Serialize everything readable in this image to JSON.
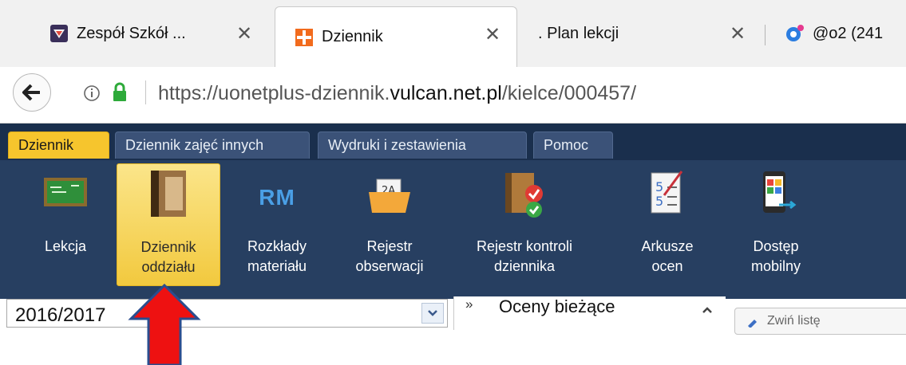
{
  "browser": {
    "tabs": [
      {
        "title": "Zespół Szkół ...",
        "icon": "school-shield-icon",
        "active": false
      },
      {
        "title": "Dziennik",
        "icon": "vulcan-plus-icon",
        "active": true
      },
      {
        "title": ". Plan lekcji",
        "icon": "",
        "active": false
      },
      {
        "title": "@o2 (241",
        "icon": "o2-mail-icon",
        "active": false
      }
    ],
    "url_path_prefix": "https://uonetplus-dziennik.",
    "url_host": "vulcan.net.pl",
    "url_suffix": "/kielce/000457/"
  },
  "app": {
    "menu_tabs": [
      {
        "label": "Dziennik",
        "active": true
      },
      {
        "label": "Dziennik zajęć innych",
        "active": false
      },
      {
        "label": "Wydruki i zestawienia",
        "active": false
      },
      {
        "label": "Pomoc",
        "active": false
      }
    ],
    "ribbon": [
      {
        "line1": "Lekcja",
        "line2": "",
        "icon": "chalkboard-icon",
        "selected": false
      },
      {
        "line1": "Dziennik",
        "line2": "oddziału",
        "icon": "class-register-book-icon",
        "selected": true
      },
      {
        "line1": "Rozkłady",
        "line2": "materiału",
        "icon": "rm-icon",
        "icon_text": "RM",
        "selected": false
      },
      {
        "line1": "Rejestr",
        "line2": "obserwacji",
        "icon": "folder-observation-icon",
        "selected": false
      },
      {
        "line1": "Rejestr kontroli",
        "line2": "dziennika",
        "icon": "register-check-icon",
        "selected": false
      },
      {
        "line1": "Arkusze",
        "line2": "ocen",
        "icon": "grade-sheet-icon",
        "selected": false
      },
      {
        "line1": "Dostęp",
        "line2": "mobilny",
        "icon": "mobile-access-icon",
        "selected": false
      }
    ],
    "year_select": {
      "value": "2016/2017"
    },
    "grades_panel": {
      "chevron": "»",
      "title": "Oceny bieżące"
    },
    "side_button_label": "Zwiń listę"
  },
  "colors": {
    "navy": "#1d3557",
    "ribbon": "#273f61",
    "active_tab": "#f6c52d",
    "highlight": "#f2c93e",
    "arrow": "#ee1111"
  }
}
